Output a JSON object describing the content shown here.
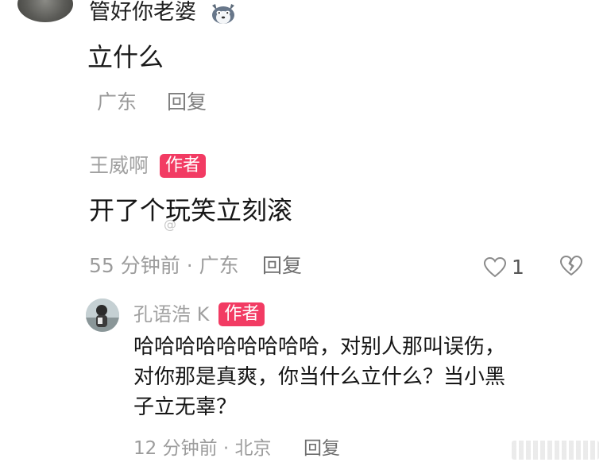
{
  "thread": {
    "top_text": "管好你老婆",
    "top_emoji": "husky-face-icon",
    "comment_1": {
      "text": "立什么",
      "location": "广东",
      "reply_label": "回复"
    },
    "comment_2": {
      "author": "王威啊",
      "badge": "作者",
      "text": "开了个玩笑立刻滚",
      "watermark": "@",
      "time_location": "55 分钟前 · 广东",
      "reply_label": "回复",
      "like_count": "1"
    },
    "reply": {
      "author": "孔语浩 K",
      "badge": "作者",
      "lines": [
        "哈哈哈哈哈哈哈哈哈，对别人那叫误伤，",
        "对你那是真爽，你当什么立什么？当小黑",
        "子立无辜？"
      ],
      "time_location": "12 分钟前 · 北京",
      "reply_label": "回复"
    }
  },
  "colors": {
    "badge": "#f23b63",
    "meta_text": "#9c9c9c",
    "body_text": "#161616"
  }
}
